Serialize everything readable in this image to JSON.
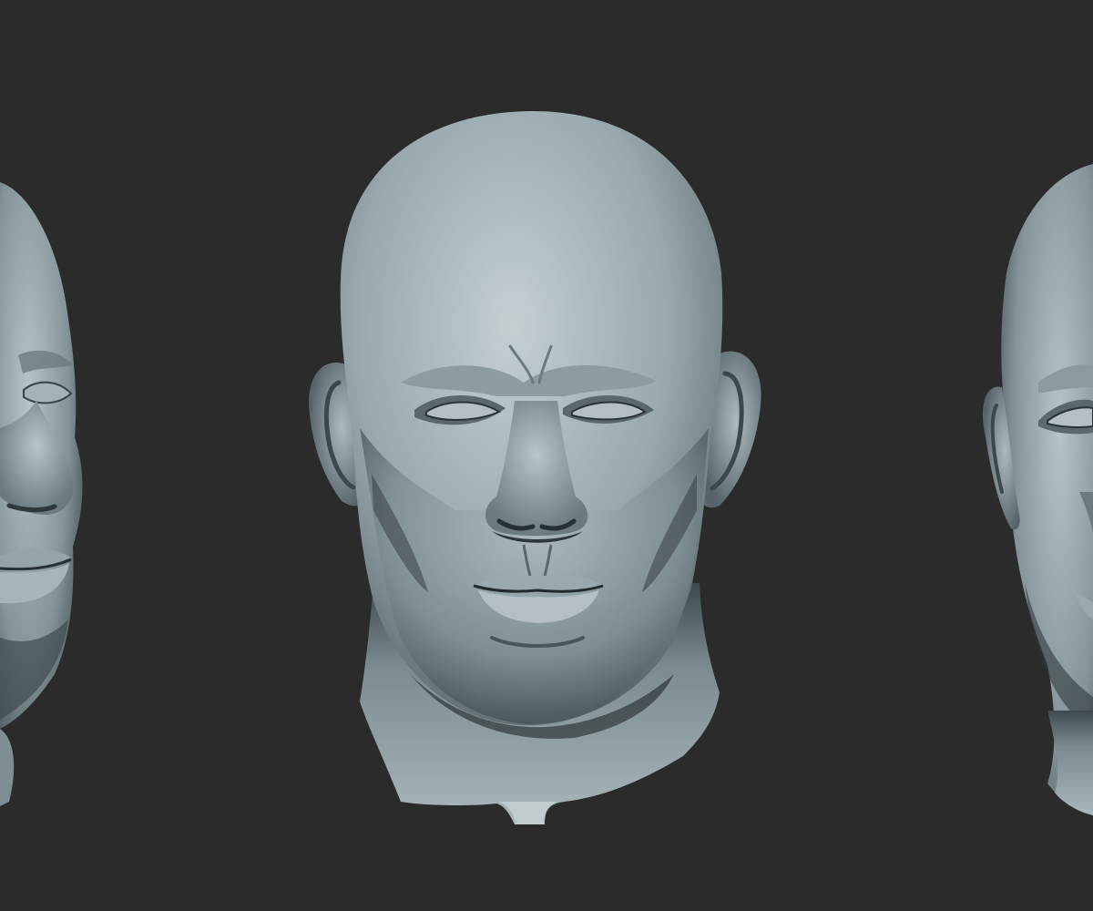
{
  "scene": {
    "subject": "sculpted-head",
    "views": [
      "left-three-quarter",
      "front",
      "right-three-quarter"
    ]
  },
  "colors": {
    "background": "#2b2b2b",
    "clay_light": "#b7c3c6",
    "clay_mid": "#8a9a9e",
    "clay_dark": "#4a5659",
    "clay_shadow": "#2f383b",
    "cavity": "#1f2628"
  }
}
